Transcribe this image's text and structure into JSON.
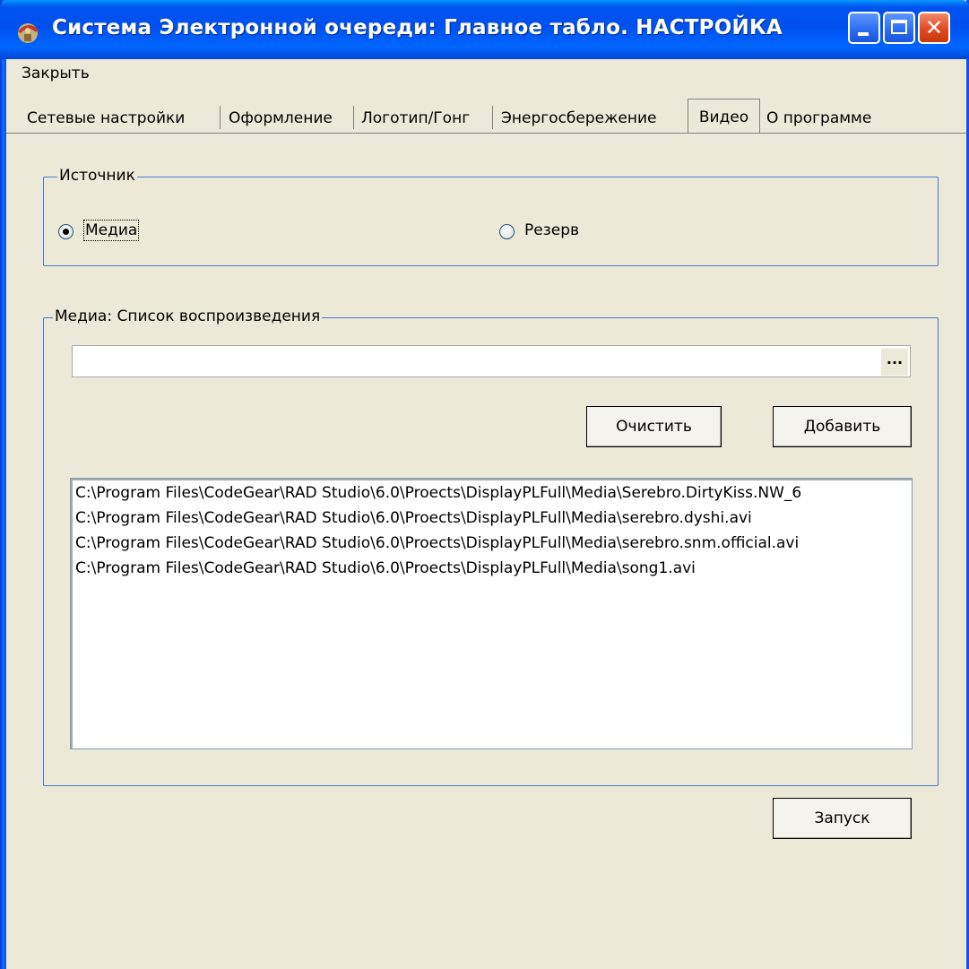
{
  "window": {
    "title": "Система  Электронной очереди: Главное табло. НАСТРОЙКА",
    "close_glyph": "✕",
    "icons": {
      "app": "app-icon",
      "minimize": "minimize-icon",
      "maximize": "maximize-icon",
      "close": "close-icon"
    }
  },
  "menu": {
    "items": [
      {
        "label": "Закрыть"
      }
    ]
  },
  "tabs": {
    "items": [
      {
        "label": "Сетевые настройки"
      },
      {
        "label": "Оформление"
      },
      {
        "label": "Логотип/Гонг"
      },
      {
        "label": "Энергосбережение"
      },
      {
        "label": "Видео",
        "active": true
      },
      {
        "label": "О программе"
      }
    ]
  },
  "source": {
    "title": "Источник",
    "options": [
      {
        "label": "Медиа",
        "selected": true
      },
      {
        "label": "Резерв",
        "selected": false
      }
    ]
  },
  "playlist": {
    "title": "Медиа: Список воспроизведения",
    "path_value": "",
    "browse_label": "...",
    "clear_label": "Очистить",
    "add_label": "Добавить",
    "items": [
      "C:\\Program Files\\CodeGear\\RAD Studio\\6.0\\Proects\\DisplayPLFull\\Media\\Serebro.DirtyKiss.NW_6",
      "C:\\Program Files\\CodeGear\\RAD Studio\\6.0\\Proects\\DisplayPLFull\\Media\\serebro.dyshi.avi",
      "C:\\Program Files\\CodeGear\\RAD Studio\\6.0\\Proects\\DisplayPLFull\\Media\\serebro.snm.official.avi",
      "C:\\Program Files\\CodeGear\\RAD Studio\\6.0\\Proects\\DisplayPLFull\\Media\\song1.avi"
    ]
  },
  "footer": {
    "start_label": "Запуск"
  },
  "colors": {
    "titlebar": "#0053EE",
    "window_bg": "#ECE9D8",
    "group_border": "#4A7BCC",
    "close_button": "#E04A22"
  }
}
